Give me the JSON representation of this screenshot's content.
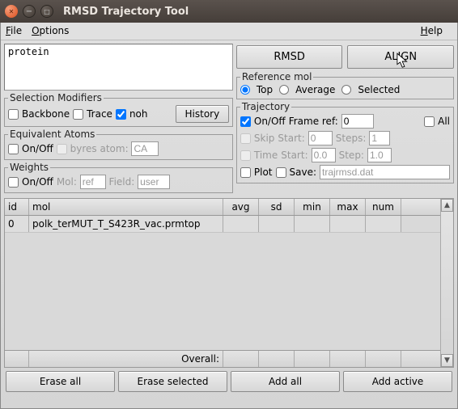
{
  "window": {
    "title": "RMSD Trajectory Tool"
  },
  "menu": {
    "file": "File",
    "options": "Options",
    "help": "Help"
  },
  "selection": {
    "value": "protein"
  },
  "actions": {
    "rmsd": "RMSD",
    "align": "ALIGN"
  },
  "ref_mol": {
    "legend": "Reference mol",
    "top": "Top",
    "average": "Average",
    "selected": "Selected",
    "choice": "top"
  },
  "sel_mod": {
    "legend": "Selection Modifiers",
    "backbone": "Backbone",
    "trace": "Trace",
    "noh": "noh",
    "noh_checked": true,
    "history": "History"
  },
  "equiv": {
    "legend": "Equivalent Atoms",
    "onoff": "On/Off",
    "byres_label": "byres atom:",
    "byres_value": "CA"
  },
  "traj": {
    "legend": "Trajectory",
    "onoff": "On/Off",
    "onoff_checked": true,
    "frame_ref_label": "Frame ref:",
    "frame_ref_value": "0",
    "all": "All",
    "skip": "Skip",
    "skip_start_label": "Start:",
    "skip_start": "0",
    "skip_steps_label": "Steps:",
    "skip_steps": "1",
    "time": "Time",
    "time_start_label": "Start:",
    "time_start": "0.0",
    "time_step_label": "Step:",
    "time_step": "1.0",
    "plot": "Plot",
    "save": "Save:",
    "save_value": "trajrmsd.dat"
  },
  "weights": {
    "legend": "Weights",
    "onoff": "On/Off",
    "mol_label": "Mol:",
    "mol_value": "ref",
    "field_label": "Field:",
    "field_value": "user"
  },
  "table": {
    "headers": {
      "id": "id",
      "mol": "mol",
      "avg": "avg",
      "sd": "sd",
      "min": "min",
      "max": "max",
      "num": "num"
    },
    "rows": [
      {
        "id": "0",
        "mol": "polk_terMUT_T_S423R_vac.prmtop",
        "avg": "",
        "sd": "",
        "min": "",
        "max": "",
        "num": ""
      }
    ],
    "overall_label": "Overall:"
  },
  "bottom": {
    "erase_all": "Erase all",
    "erase_selected": "Erase selected",
    "add_all": "Add all",
    "add_active": "Add active"
  }
}
